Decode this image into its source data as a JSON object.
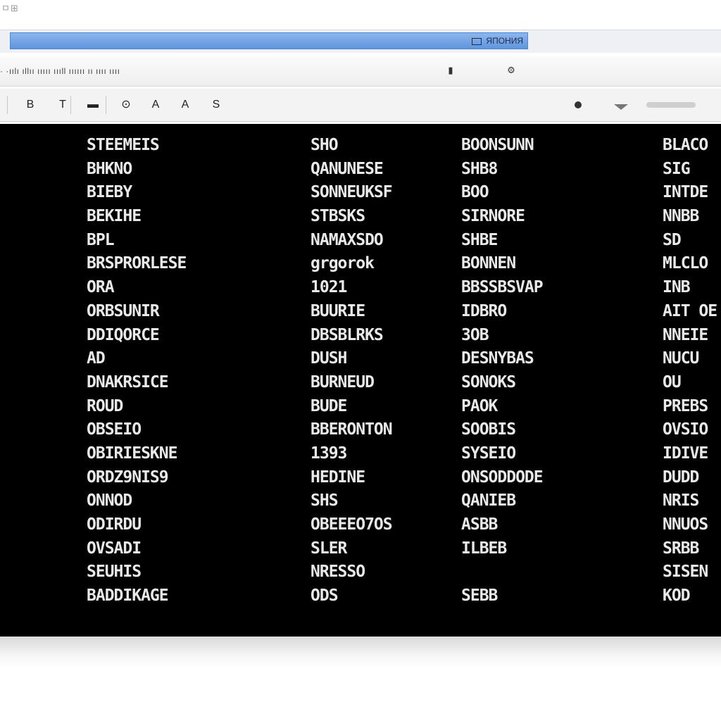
{
  "corner_text": "ㅁ⊞",
  "window": {
    "title_label": "ЯПОНИЯ"
  },
  "menubar": {
    "text": "  ·    ·ıılı ıllıı ııııı ıııll ıııııı ıı ıııı ıııı",
    "buttons": [
      "▮",
      "⚙"
    ]
  },
  "toolbar": {
    "tools": [
      "B",
      "T",
      "▬",
      "⊙",
      "A",
      "A",
      "S"
    ]
  },
  "terminal": {
    "columns": [
      [
        "STEEMEIS",
        "BHKNO",
        "BIEBY",
        "BEKIHE",
        "BPL",
        "BRSPRORLESE",
        "ORA",
        "ORBSUNIR",
        "DDIQORCE",
        "AD",
        "DNAKRSICE",
        "ROUD",
        "OBSEIO",
        "OBIRIESKNE",
        "ORDZ9NIS9",
        "ONNOD",
        "ODIRDU",
        "OVSADI",
        "SEUHIS",
        "BADDIKAGE"
      ],
      [
        "SHO",
        "QANUNESE",
        "SONNEUKSF",
        "STBSKS",
        "NAMAXSDO",
        "grgorok",
        "1021",
        "BUURIE",
        "DBSBLRKS",
        "DUSH",
        "BURNEUD",
        "BUDE",
        "BBERONTON",
        "1393",
        "HEDINE",
        "SHS",
        "OBEEEO7OS",
        "SLER",
        "NRESSO",
        "ODS"
      ],
      [
        "BOONSUNN",
        "SHB8",
        "BOO",
        "SIRNORE",
        "SHBE",
        "BONNEN",
        "BBSSBSVAP",
        "IDBRO",
        "3OB",
        "DESNYBAS",
        "SONOKS",
        "PAOK",
        "SOOBIS",
        "SYSEIO",
        "ONSODDODE",
        "QANIEB",
        "ASBB",
        "ILBEB",
        "",
        "SEBB"
      ],
      [
        "BLACO",
        "SIG",
        "INTDE",
        "NNBB",
        "SD",
        "MLCLO",
        "INB",
        "AIT OE",
        "NNEIE",
        "NUCU",
        "OU",
        "PREBS",
        "OVSIO",
        "IDIVE",
        "DUDD",
        "NRIS",
        "NNUOS",
        "SRBB",
        "SISEN",
        "KOD"
      ]
    ]
  }
}
